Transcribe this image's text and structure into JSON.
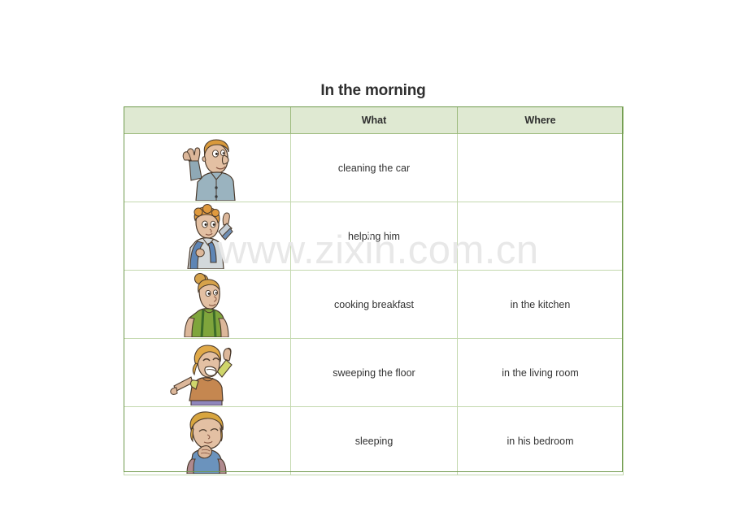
{
  "document": {
    "title": "In the morning",
    "watermark": "www.zixin.com.cn"
  },
  "table": {
    "columns": [
      {
        "key": "picture",
        "label": ""
      },
      {
        "key": "what",
        "label": "What"
      },
      {
        "key": "where",
        "label": "Where"
      }
    ],
    "header_background": "#dfe9d2",
    "border_color": "#6f9a4d",
    "inner_border_color": "#c3d8ae",
    "rows": [
      {
        "picture": "man-waving-blue-shirt",
        "what": "cleaning the car",
        "where": ""
      },
      {
        "picture": "boy-with-backpack-waving",
        "what": "helping him",
        "where": ""
      },
      {
        "picture": "woman-green-shirt-hair-bun",
        "what": "cooking breakfast",
        "where": "in the kitchen"
      },
      {
        "picture": "girl-laughing-arms-raised",
        "what": "sweeping the floor",
        "where": "in the living room"
      },
      {
        "picture": "boy-sleeping-hands-clasped",
        "what": "sleeping",
        "where": "in his bedroom"
      }
    ]
  }
}
